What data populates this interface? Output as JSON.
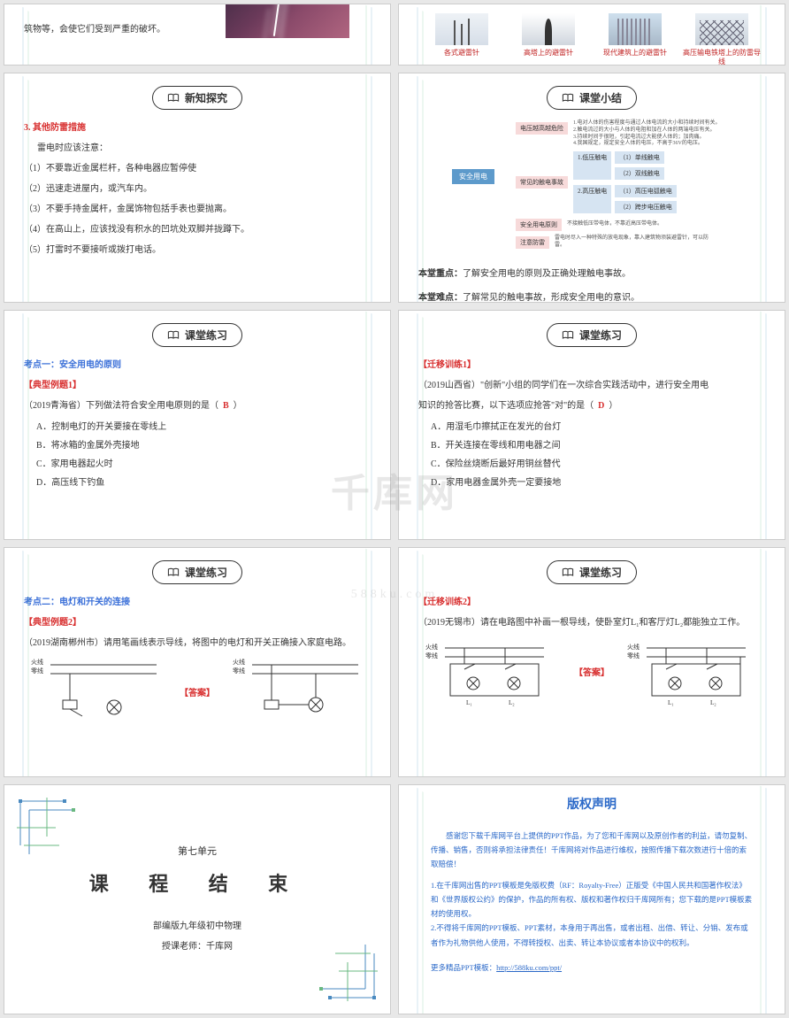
{
  "headers": {
    "xinzhi": "新知探究",
    "xiaojie": "课堂小结",
    "lianxi": "课堂练习"
  },
  "slide1": {
    "text": "筑物等，会使它们受到严重的破坏。"
  },
  "slide2": {
    "captions": [
      "各式避雷针",
      "高塔上的避雷针",
      "现代建筑上的避雷针",
      "高压输电铁塔上的防雷导线"
    ]
  },
  "slide3": {
    "title": "3. 其他防雷措施",
    "sub": "雷电时应该注意：",
    "items": [
      "（1）不要靠近金属栏杆，各种电器应暂停使",
      "（2）迅速走进屋内，或汽车内。",
      "（3）不要手持金属杆，金属饰物包括手表也要抛离。",
      "（4）在高山上，应该找没有积水的凹坑处双脚并拢蹲下。",
      "（5）打雷时不要接听或拨打电话。"
    ]
  },
  "slide4": {
    "root": "安全用电",
    "branches": {
      "a": "电压越高越危险",
      "b": "常见的触电事故",
      "b1": "1.低压触电",
      "b2": "2.高压触电",
      "b1a": "（1）单线触电",
      "b1b": "（2）双线触电",
      "b2a": "（1）高压电弧触电",
      "b2b": "（2）跨步电压触电",
      "c": "安全用电原则",
      "c1": "不接触低压带电体，不靠近高压带电体。",
      "d": "注意防雷",
      "d1": "雷电时尽入一种特殊的放电现象，靠入建筑物须装避雷针，可以防雷。"
    },
    "notes": [
      "1.电对人体的伤害程度与通过人体电流的大小和持续时间有关。",
      "2.触电流过的大小与人体的电阻和加在人体的两端电压有关。",
      "3.持续时间于很短，引起电流过大能使人体的；加肉痛。",
      "4.我国规定，规定安全人体的电压，不高于36V的电压。"
    ],
    "key_label": "本堂重点：",
    "key_text": "了解安全用电的原则及正确处理触电事故。",
    "diff_label": "本堂难点：",
    "diff_text": "了解常见的触电事故，形成安全用电的意识。"
  },
  "slide5": {
    "kaodian": "考点一：安全用电的原则",
    "liti": "【典型例题1】",
    "stem": "（2019青海省）下列做法符合安全用电原则的是（",
    "answer": "B",
    "close": "）",
    "opts": [
      "A．控制电灯的开关要接在零线上",
      "B．将冰箱的金属外壳接地",
      "C．家用电器起火时",
      "D．高压线下钓鱼"
    ]
  },
  "slide6": {
    "qy": "【迁移训练1】",
    "stem1": "（2019山西省）\"创新\"小组的同学们在一次综合实践活动中，进行安全用电",
    "stem2": "知识的抢答比赛，以下选项应抢答\"对\"的是（",
    "answer": "D",
    "close": "）",
    "opts": [
      "A．用湿毛巾擦拭正在发光的台灯",
      "B．开关连接在零线和用电器之间",
      "C．保险丝烧断后最好用铜丝替代",
      "D．家用电器金属外壳一定要接地"
    ]
  },
  "slide7": {
    "kaodian": "考点二：电灯和开关的连接",
    "liti": "【典型例题2】",
    "stem": "（2019湖南郴州市）请用笔画线表示导线，将图中的电灯和开关正确接入家庭电路。",
    "ans_label": "【答案】",
    "wire_labels": {
      "fire": "火线",
      "zero": "零线"
    }
  },
  "slide8": {
    "qy": "【迁移训练2】",
    "stem": "（2019无锡市）请在电路图中补画一根导线，使卧室灯L₁和客厅灯L₂都能独立工作。",
    "ans_label": "【答案】",
    "wire_labels": {
      "fire": "火线",
      "zero": "零线"
    },
    "lamp_labels": {
      "l1": "L₁",
      "l2": "L₂"
    }
  },
  "slide9": {
    "unit": "第七单元",
    "title": "课 程 结 束",
    "sub1": "部编版九年级初中物理",
    "sub2": "授课老师：千库网"
  },
  "slide10": {
    "title": "版权声明",
    "p1": "感谢您下载千库网平台上提供的PPT作品，为了您和千库网以及原创作者的利益，请勿复制、传播、销售，否则将承担法律责任！千库网将对作品进行维权，按照传播下载次数进行十倍的索取赔偿！",
    "p2": "1.在千库网出售的PPT模板是免版权费（RF：Royalty-Free）正版受《中国人民共和国著作权法》和《世界版权公约》的保护，作品的所有权、版权和著作权归千库网所有；您下载的是PPT模板素材的使用权。",
    "p3": "2.不得将千库网的PPT模板、PPT素材，本身用于再出售，或者出租、出借、转让、分销、发布或者作为礼物供他人使用，不得转授权、出卖、转让本协议或者本协议中的权利。",
    "footer_label": "更多精品PPT模板：",
    "footer_url": "http://588ku.com/ppt/"
  },
  "watermark": {
    "main": "千库网",
    "sub": "588ku.com"
  }
}
